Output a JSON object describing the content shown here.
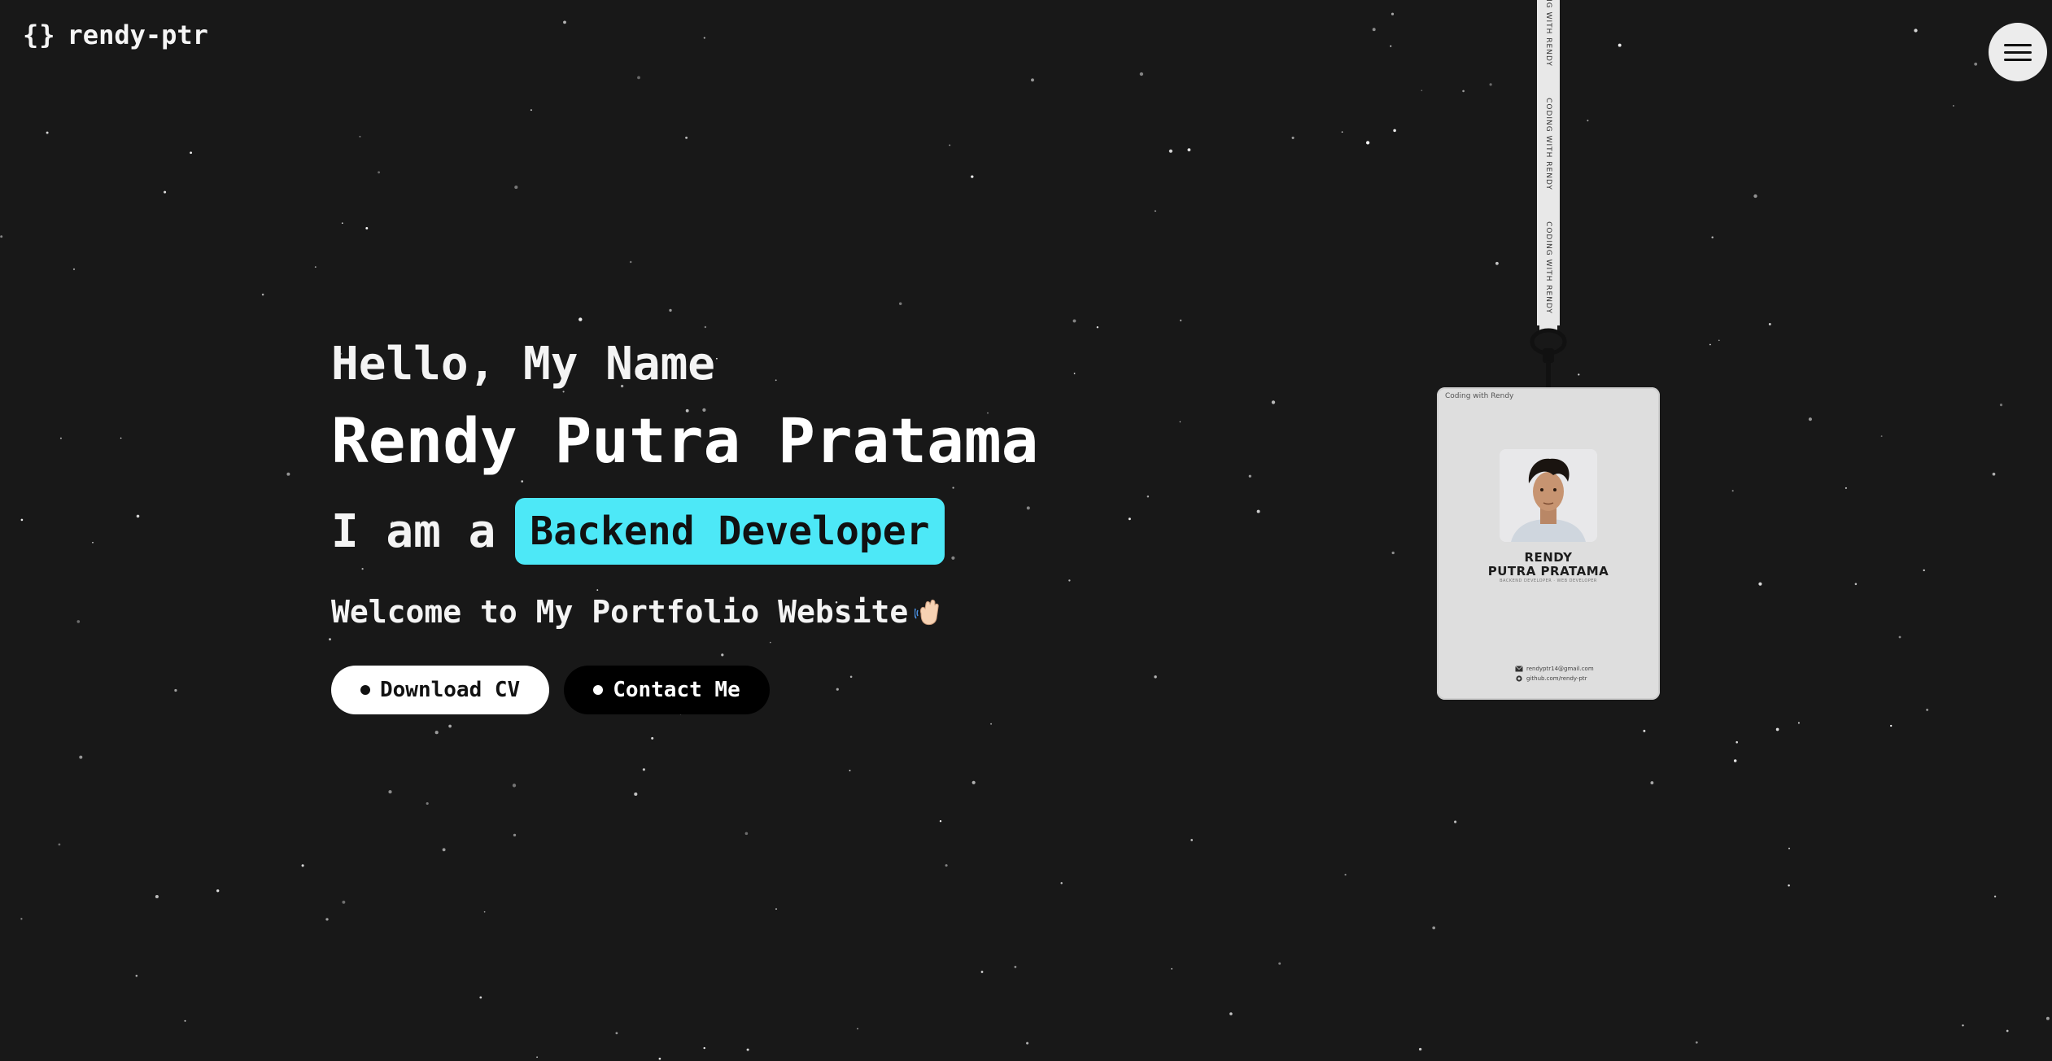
{
  "header": {
    "logo_icon": "{}",
    "logo_text": "rendy-ptr",
    "menu_icon": "hamburger-menu-icon"
  },
  "hero": {
    "greeting": "Hello, My Name",
    "name": "Rendy Putra Pratama",
    "role_prefix": "I am a",
    "role": "Backend Developer",
    "welcome": "Welcome to My Portfolio Website",
    "welcome_icon": "waving-hand-icon",
    "buttons": {
      "download_cv": "Download CV",
      "contact_me": "Contact Me"
    }
  },
  "id_card": {
    "lanyard_text": "CODING WITH RENDY",
    "brand": "Coding with Rendy",
    "first_name": "RENDY",
    "last_name": "PUTRA PRATAMA",
    "subtitle": "BACKEND DEVELOPER · WEB DEVELOPER",
    "email": "rendyptr14@gmail.com",
    "github": "github.com/rendy-ptr"
  },
  "colors": {
    "background": "#181818",
    "accent": "#4de8f7",
    "text": "#f4f4f4"
  }
}
